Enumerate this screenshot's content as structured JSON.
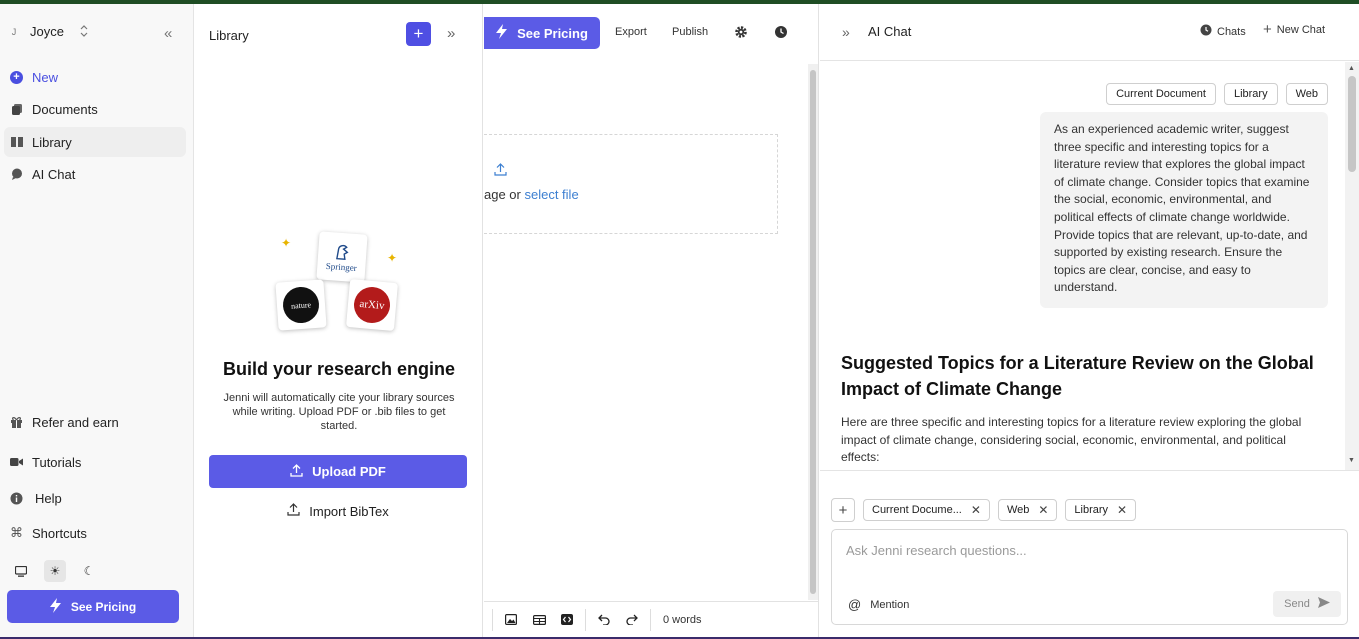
{
  "sidebar": {
    "user": {
      "initial": "J",
      "name": "Joyce"
    },
    "nav": [
      {
        "label": "New",
        "icon": "plus-circle-icon"
      },
      {
        "label": "Documents",
        "icon": "documents-icon"
      },
      {
        "label": "Library",
        "icon": "library-icon"
      },
      {
        "label": "AI Chat",
        "icon": "chat-bubble-icon"
      }
    ],
    "bottom_nav": [
      {
        "label": "Refer and earn",
        "icon": "gift-icon"
      },
      {
        "label": "Tutorials",
        "icon": "video-icon"
      },
      {
        "label": "Help",
        "icon": "info-icon"
      },
      {
        "label": "Shortcuts",
        "icon": "command-icon"
      }
    ],
    "pricing_label": "See Pricing"
  },
  "library": {
    "title": "Library",
    "logos": {
      "springer": "Springer",
      "nature": "nature",
      "arxiv": "arXiv"
    },
    "heading": "Build your research engine",
    "description": "Jenni will automatically cite your library sources while writing. Upload PDF or .bib files to get started.",
    "upload_label": "Upload PDF",
    "import_label": "Import BibTex"
  },
  "editor": {
    "pricing_label": "See Pricing",
    "export_label": "Export",
    "publish_label": "Publish",
    "dropzone_text": "age or ",
    "dropzone_link": "select file",
    "word_count": "0 words"
  },
  "chat": {
    "title": "AI Chat",
    "chats_label": "Chats",
    "new_chat_label": "New Chat",
    "source_chips": [
      "Current Document",
      "Library",
      "Web"
    ],
    "user_message": "As an experienced academic writer, suggest three specific and interesting topics for a literature review that explores the global impact of climate change. Consider topics that examine the social, economic, environmental, and political effects of climate change worldwide. Provide topics that are relevant, up-to-date, and supported by existing research. Ensure the topics are clear, concise, and easy to understand.",
    "answer_heading": "Suggested Topics for a Literature Review on the Global Impact of Climate Change",
    "answer_intro": "Here are three specific and interesting topics for a literature review exploring the global impact of climate change, considering social, economic, environmental, and political effects:",
    "context_chips": [
      "Current Docume...",
      "Web",
      "Library"
    ],
    "input_placeholder": "Ask Jenni research questions...",
    "mention_label": "Mention",
    "send_label": "Send"
  },
  "colors": {
    "accent": "#5b5be6",
    "link": "#3c7fd1"
  }
}
